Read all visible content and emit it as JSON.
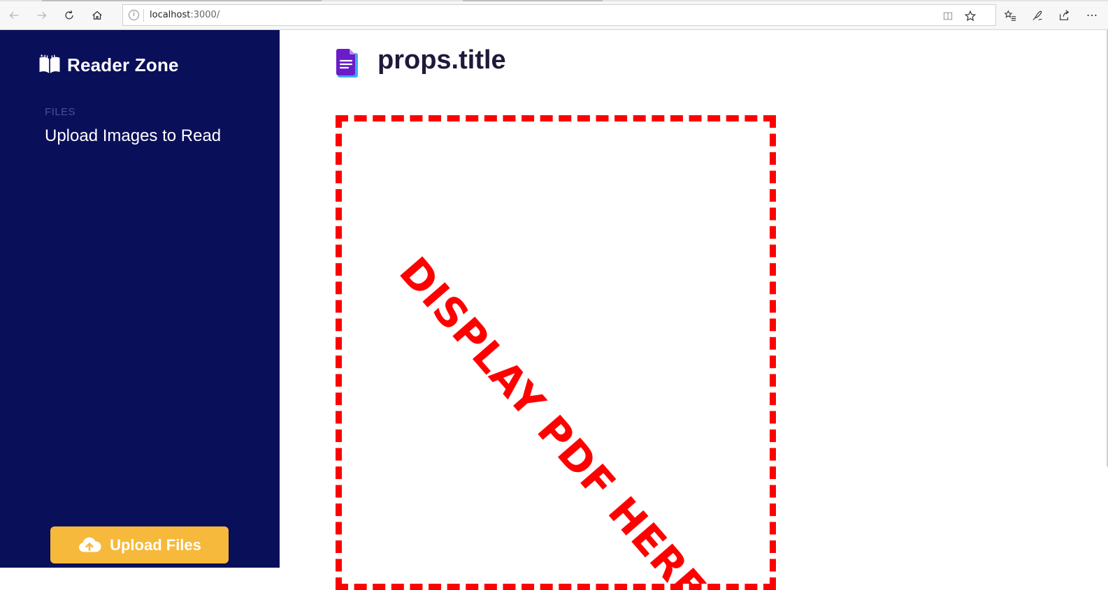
{
  "browser": {
    "url_host": "localhost",
    "url_rest": ":3000/"
  },
  "sidebar": {
    "brand": "Reader Zone",
    "section_label": "FILES",
    "items": [
      {
        "label": "Upload Images to Read"
      }
    ],
    "upload_button_label": "Upload Files"
  },
  "main": {
    "title": "props.title",
    "placeholder_text": "DISPLAY PDF HERE"
  },
  "colors": {
    "sidebar_bg": "#0a0f5a",
    "upload_button": "#f6b93b",
    "placeholder_border": "#ff0000",
    "doc_icon": "#6a1cc9"
  }
}
